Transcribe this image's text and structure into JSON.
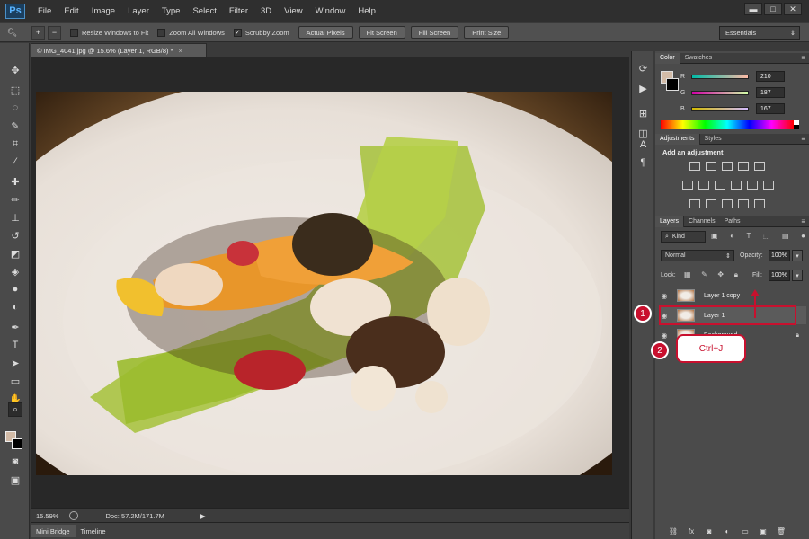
{
  "app": {
    "logo": "Ps"
  },
  "menu": [
    "File",
    "Edit",
    "Image",
    "Layer",
    "Type",
    "Select",
    "Filter",
    "3D",
    "View",
    "Window",
    "Help"
  ],
  "window_controls": {
    "minimize": "▬",
    "maximize": "□",
    "close": "✕"
  },
  "options_bar": {
    "resize_windows": "Resize Windows to Fit",
    "zoom_all": "Zoom All Windows",
    "scrubby_zoom": "Scrubby Zoom",
    "scrubby_checked": "✓",
    "actual_pixels": "Actual Pixels",
    "fit_screen": "Fit Screen",
    "fill_screen": "Fill Screen",
    "print_size": "Print Size",
    "workspace": "Essentials"
  },
  "document": {
    "tab_title": "© IMG_4041.jpg @ 15.6% (Layer 1, RGB/8) *",
    "tab_close": "×"
  },
  "status": {
    "zoom": "15.59%",
    "doc": "Doc: 57.2M/171.7M"
  },
  "bottom_tabs": [
    "Mini Bridge",
    "Timeline"
  ],
  "color_panel": {
    "tabs": [
      "Color",
      "Swatches"
    ],
    "r_label": "R",
    "g_label": "G",
    "b_label": "B",
    "r": "210",
    "g": "187",
    "b": "167",
    "swatch_color": "#d2bba7"
  },
  "adjustments_panel": {
    "tabs": [
      "Adjustments",
      "Styles"
    ],
    "heading": "Add an adjustment"
  },
  "layers_panel": {
    "tabs": [
      "Layers",
      "Channels",
      "Paths"
    ],
    "kind": "Kind",
    "blend_mode": "Normal",
    "opacity_label": "Opacity:",
    "opacity": "100%",
    "lock_label": "Lock:",
    "fill_label": "Fill:",
    "fill": "100%",
    "layers": [
      {
        "name": "Layer 1 copy"
      },
      {
        "name": "Layer 1"
      },
      {
        "name": "Background"
      }
    ]
  },
  "annotations": {
    "step1": "1",
    "step2": "2",
    "shortcut": "Ctrl+J",
    "highlight_color": "#c8102e"
  }
}
